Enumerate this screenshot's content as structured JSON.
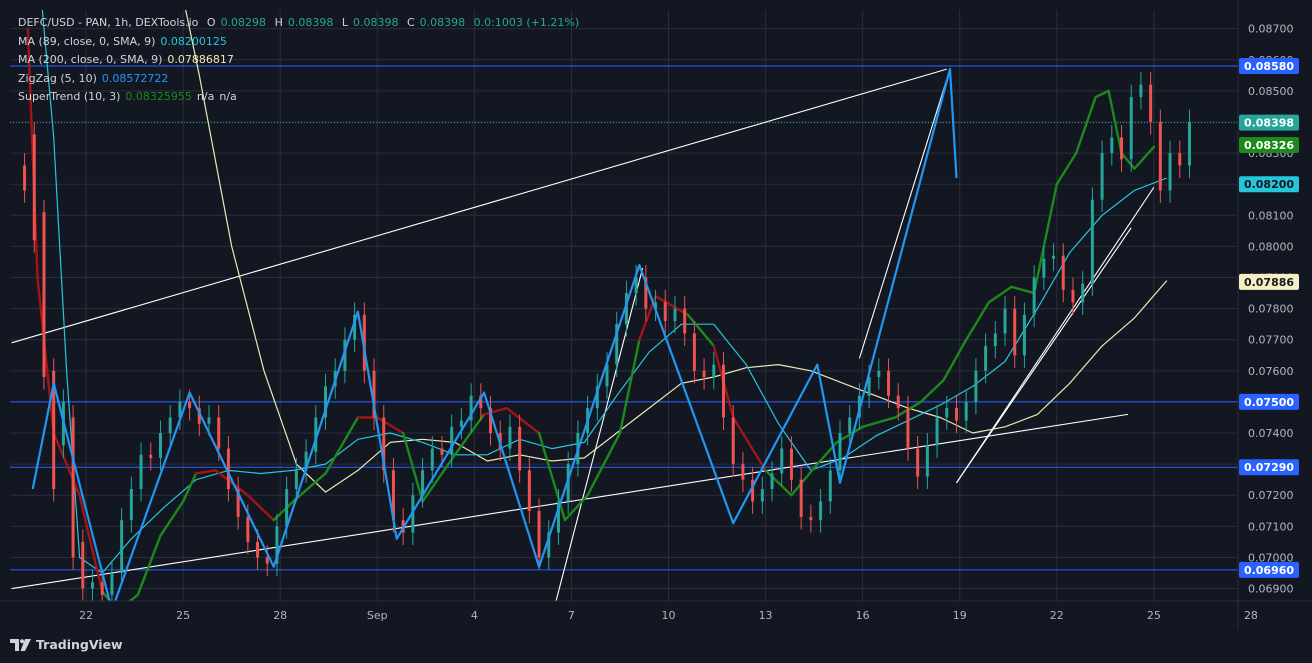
{
  "legend": {
    "symbol": "DEFC/USD - PAN, 1h, DEXTools.io",
    "o_label": "O",
    "o_val": "0.08298",
    "h_label": "H",
    "h_val": "0.08398",
    "l_label": "L",
    "l_val": "0.08398",
    "c_label": "C",
    "c_val": "0.08398",
    "change": "0.0:1003 (+1.21%)",
    "ma89_label": "MA (89, close, 0, SMA, 9)",
    "ma89_val": "0.08200125",
    "ma200_label": "MA (200, close, 0, SMA, 9)",
    "ma200_val": "0.07886817",
    "zz_label": "ZigZag (5, 10)",
    "zz_val": "0.08572722",
    "st_label": "SuperTrend (10, 3)",
    "st_val": "0.08325955",
    "st_na1": "n/a",
    "st_na2": "n/a"
  },
  "footer": {
    "brand": "TradingView"
  },
  "colors": {
    "background": "#131722",
    "grid": "#2a2e39",
    "up": "#26a69a",
    "down": "#ef5350",
    "zigzag": "#2196f3",
    "ma89": "#26c6da",
    "ma200": "#f0e6b4",
    "hline": "#2962ff",
    "trendline": "#ffffff",
    "supertrend_up": "#1b8a1b",
    "supertrend_down": "#a31515"
  },
  "chart_data": {
    "type": "candlestick",
    "title": "DEFC/USD - PAN, 1h, DEXTools.io",
    "y_axis": {
      "ticks": [
        "0.08700",
        "0.08600",
        "0.08500",
        "0.08400",
        "0.08300",
        "0.08200",
        "0.08100",
        "0.08000",
        "0.07900",
        "0.07800",
        "0.07700",
        "0.07600",
        "0.07500",
        "0.07400",
        "0.07300",
        "0.07200",
        "0.07100",
        "0.07000",
        "0.06900"
      ],
      "ylim": [
        0.0686,
        0.0876
      ]
    },
    "x_axis": {
      "ticks": [
        "22",
        "25",
        "28",
        "Sep",
        "4",
        "7",
        "10",
        "13",
        "16",
        "19",
        "22",
        "25",
        "28"
      ],
      "day_index": [
        2,
        5,
        8,
        11,
        14,
        17,
        20,
        23,
        26,
        29,
        32,
        35,
        38
      ]
    },
    "horizontal_levels": [
      {
        "value": 0.0858,
        "label": "0.08580",
        "color": "#2962ff"
      },
      {
        "value": 0.075,
        "label": "0.07500",
        "color": "#2962ff"
      },
      {
        "value": 0.0729,
        "label": "0.07290",
        "color": "#2962ff"
      },
      {
        "value": 0.0696,
        "label": "0.06960",
        "color": "#2962ff"
      }
    ],
    "price_labels": [
      {
        "value": 0.08398,
        "label": "0.08398",
        "bg": "#26a69a",
        "fg": "#ffffff"
      },
      {
        "value": 0.08326,
        "label": "0.08326",
        "bg": "#1b8a1b",
        "fg": "#ffffff"
      },
      {
        "value": 0.082,
        "label": "0.08200",
        "bg": "#26c6da",
        "fg": "#131722"
      },
      {
        "value": 0.07886,
        "label": "0.07886",
        "bg": "#f7efc4",
        "fg": "#131722"
      }
    ],
    "last_price": 0.08398,
    "zigzag": [
      [
        0.0,
        0.0722
      ],
      [
        1.0,
        0.0756
      ],
      [
        2.8,
        0.0683
      ],
      [
        5.3,
        0.0753
      ],
      [
        7.8,
        0.0697
      ],
      [
        10.4,
        0.0779
      ],
      [
        11.6,
        0.0706
      ],
      [
        14.4,
        0.0753
      ],
      [
        16.0,
        0.0697
      ],
      [
        19.0,
        0.0794
      ],
      [
        22.0,
        0.0711
      ],
      [
        24.6,
        0.0762
      ],
      [
        25.3,
        0.0724
      ],
      [
        28.7,
        0.0857
      ],
      [
        29.8,
        0.0822
      ]
    ],
    "zigzag_days": [
      0.35,
      1.0,
      2.8,
      5.2,
      7.8,
      10.4,
      11.6,
      14.3,
      16.0,
      19.1,
      22.0,
      24.6,
      25.3,
      28.7,
      28.9
    ],
    "ma89": [
      [
        0.4,
        0.0905
      ],
      [
        1.0,
        0.0835
      ],
      [
        1.4,
        0.076
      ],
      [
        1.8,
        0.07
      ],
      [
        2.5,
        0.0695
      ],
      [
        3.4,
        0.0706
      ],
      [
        4.4,
        0.0716
      ],
      [
        5.4,
        0.0725
      ],
      [
        6.4,
        0.0728
      ],
      [
        7.4,
        0.0727
      ],
      [
        8.4,
        0.0728
      ],
      [
        9.4,
        0.073
      ],
      [
        10.4,
        0.0738
      ],
      [
        11.4,
        0.074
      ],
      [
        12.4,
        0.0737
      ],
      [
        13.4,
        0.0733
      ],
      [
        14.4,
        0.0733
      ],
      [
        15.4,
        0.0738
      ],
      [
        16.4,
        0.0735
      ],
      [
        17.4,
        0.0737
      ],
      [
        18.4,
        0.0752
      ],
      [
        19.4,
        0.0766
      ],
      [
        20.4,
        0.0775
      ],
      [
        21.4,
        0.0775
      ],
      [
        22.4,
        0.0762
      ],
      [
        23.4,
        0.0743
      ],
      [
        24.4,
        0.0728
      ],
      [
        25.4,
        0.0732
      ],
      [
        26.4,
        0.0739
      ],
      [
        27.4,
        0.0744
      ],
      [
        28.4,
        0.0749
      ],
      [
        29.4,
        0.0755
      ],
      [
        30.4,
        0.0763
      ],
      [
        31.4,
        0.078
      ],
      [
        32.4,
        0.0798
      ],
      [
        33.4,
        0.081
      ],
      [
        34.4,
        0.0818
      ],
      [
        35.4,
        0.0822
      ]
    ],
    "ma200": [
      [
        4.5,
        0.0905
      ],
      [
        5.5,
        0.0855
      ],
      [
        6.5,
        0.08
      ],
      [
        7.5,
        0.076
      ],
      [
        8.5,
        0.073
      ],
      [
        9.4,
        0.0721
      ],
      [
        10.4,
        0.0728
      ],
      [
        11.4,
        0.0737
      ],
      [
        12.4,
        0.0738
      ],
      [
        13.4,
        0.0737
      ],
      [
        14.4,
        0.0731
      ],
      [
        15.4,
        0.0733
      ],
      [
        16.4,
        0.0731
      ],
      [
        17.4,
        0.0732
      ],
      [
        18.4,
        0.074
      ],
      [
        19.4,
        0.0748
      ],
      [
        20.4,
        0.0756
      ],
      [
        21.4,
        0.0758
      ],
      [
        22.4,
        0.0761
      ],
      [
        23.4,
        0.0762
      ],
      [
        24.4,
        0.076
      ],
      [
        25.4,
        0.0756
      ],
      [
        26.4,
        0.0752
      ],
      [
        27.4,
        0.0748
      ],
      [
        28.4,
        0.0745
      ],
      [
        29.4,
        0.074
      ],
      [
        30.4,
        0.0742
      ],
      [
        31.4,
        0.0746
      ],
      [
        32.4,
        0.0756
      ],
      [
        33.4,
        0.0768
      ],
      [
        34.4,
        0.0777
      ],
      [
        35.4,
        0.0789
      ]
    ],
    "supertrend": [
      [
        0.2,
        0.087,
        "d"
      ],
      [
        0.5,
        0.079,
        "d"
      ],
      [
        1.0,
        0.074,
        "d"
      ],
      [
        1.8,
        0.072,
        "d"
      ],
      [
        2.5,
        0.0689,
        "d"
      ],
      [
        3.0,
        0.0683,
        "u"
      ],
      [
        3.6,
        0.0688,
        "u"
      ],
      [
        4.3,
        0.0707,
        "u"
      ],
      [
        5.0,
        0.0718,
        "u"
      ],
      [
        5.4,
        0.0727,
        "u"
      ],
      [
        6.0,
        0.0728,
        "d"
      ],
      [
        7.0,
        0.072,
        "d"
      ],
      [
        7.8,
        0.0712,
        "d"
      ],
      [
        8.4,
        0.0718,
        "u"
      ],
      [
        9.4,
        0.0727,
        "u"
      ],
      [
        10.4,
        0.0745,
        "u"
      ],
      [
        11.0,
        0.0745,
        "d"
      ],
      [
        11.8,
        0.074,
        "d"
      ],
      [
        12.4,
        0.0718,
        "u"
      ],
      [
        13.4,
        0.0733,
        "u"
      ],
      [
        14.3,
        0.0746,
        "u"
      ],
      [
        15.0,
        0.0748,
        "d"
      ],
      [
        16.0,
        0.074,
        "d"
      ],
      [
        16.8,
        0.0712,
        "u"
      ],
      [
        17.5,
        0.072,
        "u"
      ],
      [
        18.5,
        0.074,
        "u"
      ],
      [
        19.1,
        0.077,
        "u"
      ],
      [
        19.6,
        0.0784,
        "d"
      ],
      [
        20.6,
        0.0778,
        "d"
      ],
      [
        21.4,
        0.0768,
        "u"
      ],
      [
        22.0,
        0.0745,
        "d"
      ],
      [
        23.0,
        0.0728,
        "d"
      ],
      [
        23.8,
        0.072,
        "u"
      ],
      [
        24.6,
        0.073,
        "u"
      ],
      [
        25.2,
        0.0737,
        "u"
      ],
      [
        26.0,
        0.0742,
        "u"
      ],
      [
        27.0,
        0.0745,
        "u"
      ],
      [
        27.8,
        0.075,
        "u"
      ],
      [
        28.5,
        0.0757,
        "u"
      ],
      [
        29.2,
        0.077,
        "u"
      ],
      [
        29.9,
        0.0782,
        "u"
      ],
      [
        30.6,
        0.0787,
        "u"
      ],
      [
        31.3,
        0.0785,
        "u"
      ],
      [
        32.0,
        0.082,
        "u"
      ],
      [
        32.6,
        0.083,
        "u"
      ],
      [
        33.2,
        0.0848,
        "u"
      ],
      [
        33.6,
        0.085,
        "u"
      ],
      [
        34.0,
        0.083,
        "u"
      ],
      [
        34.4,
        0.0825,
        "u"
      ],
      [
        35.0,
        0.0832,
        "u"
      ]
    ],
    "trendlines": [
      {
        "from": [
          -0.3,
          0.0769
        ],
        "to": [
          28.6,
          0.0857
        ]
      },
      {
        "from": [
          -0.3,
          0.069
        ],
        "to": [
          34.2,
          0.0746
        ]
      },
      {
        "from": [
          28.9,
          0.0724
        ],
        "to": [
          35.0,
          0.0819
        ]
      },
      {
        "from": [
          28.9,
          0.0724
        ],
        "to": [
          34.3,
          0.0806
        ]
      },
      {
        "from": [
          16.5,
          0.0685
        ],
        "to": [
          19.2,
          0.0793
        ]
      },
      {
        "from": [
          25.9,
          0.0764
        ],
        "to": [
          28.7,
          0.0857
        ]
      }
    ],
    "candles": [
      [
        0.1,
        0.0826,
        0.0818
      ],
      [
        0.4,
        0.0836,
        0.0802
      ],
      [
        0.7,
        0.0811,
        0.0758
      ],
      [
        1.0,
        0.076,
        0.0722
      ],
      [
        1.3,
        0.0736,
        0.075
      ],
      [
        1.6,
        0.0745,
        0.07
      ],
      [
        1.9,
        0.0705,
        0.069
      ],
      [
        2.2,
        0.069,
        0.0692
      ],
      [
        2.5,
        0.0692,
        0.0688
      ],
      [
        2.8,
        0.0688,
        0.0695
      ],
      [
        3.1,
        0.0695,
        0.0712
      ],
      [
        3.4,
        0.0712,
        0.0722
      ],
      [
        3.7,
        0.0722,
        0.0733
      ],
      [
        4.0,
        0.0733,
        0.0732
      ],
      [
        4.3,
        0.0732,
        0.074
      ],
      [
        4.6,
        0.074,
        0.0745
      ],
      [
        4.9,
        0.0745,
        0.075
      ],
      [
        5.2,
        0.075,
        0.0748
      ],
      [
        5.5,
        0.0748,
        0.0743
      ],
      [
        5.8,
        0.0743,
        0.0745
      ],
      [
        6.1,
        0.0745,
        0.0735
      ],
      [
        6.4,
        0.0735,
        0.0722
      ],
      [
        6.7,
        0.0722,
        0.0713
      ],
      [
        7.0,
        0.0713,
        0.0705
      ],
      [
        7.3,
        0.0705,
        0.07
      ],
      [
        7.6,
        0.07,
        0.0698
      ],
      [
        7.9,
        0.0698,
        0.071
      ],
      [
        8.2,
        0.071,
        0.0722
      ],
      [
        8.5,
        0.0722,
        0.0728
      ],
      [
        8.8,
        0.0728,
        0.0734
      ],
      [
        9.1,
        0.0734,
        0.0745
      ],
      [
        9.4,
        0.0745,
        0.0755
      ],
      [
        9.7,
        0.0755,
        0.076
      ],
      [
        10.0,
        0.076,
        0.077
      ],
      [
        10.3,
        0.077,
        0.0778
      ],
      [
        10.6,
        0.0778,
        0.076
      ],
      [
        10.9,
        0.076,
        0.0745
      ],
      [
        11.2,
        0.0745,
        0.0728
      ],
      [
        11.5,
        0.0728,
        0.0712
      ],
      [
        11.8,
        0.0712,
        0.0708
      ],
      [
        12.1,
        0.0708,
        0.072
      ],
      [
        12.4,
        0.072,
        0.0728
      ],
      [
        12.7,
        0.0728,
        0.0735
      ],
      [
        13.0,
        0.0735,
        0.0733
      ],
      [
        13.3,
        0.0733,
        0.0742
      ],
      [
        13.6,
        0.0742,
        0.0744
      ],
      [
        13.9,
        0.0744,
        0.0752
      ],
      [
        14.2,
        0.0752,
        0.0748
      ],
      [
        14.5,
        0.0748,
        0.074
      ],
      [
        14.8,
        0.074,
        0.0735
      ],
      [
        15.1,
        0.0735,
        0.0742
      ],
      [
        15.4,
        0.0742,
        0.0728
      ],
      [
        15.7,
        0.0728,
        0.0715
      ],
      [
        16.0,
        0.0715,
        0.07
      ],
      [
        16.3,
        0.07,
        0.0708
      ],
      [
        16.6,
        0.0708,
        0.0718
      ],
      [
        16.9,
        0.0718,
        0.073
      ],
      [
        17.2,
        0.073,
        0.074
      ],
      [
        17.5,
        0.074,
        0.0748
      ],
      [
        17.8,
        0.0748,
        0.0755
      ],
      [
        18.1,
        0.0755,
        0.0762
      ],
      [
        18.4,
        0.0762,
        0.0775
      ],
      [
        18.7,
        0.0775,
        0.0785
      ],
      [
        19.0,
        0.0785,
        0.079
      ],
      [
        19.3,
        0.079,
        0.078
      ],
      [
        19.6,
        0.078,
        0.0782
      ],
      [
        19.9,
        0.0782,
        0.0776
      ],
      [
        20.2,
        0.0776,
        0.078
      ],
      [
        20.5,
        0.078,
        0.0772
      ],
      [
        20.8,
        0.0772,
        0.076
      ],
      [
        21.1,
        0.076,
        0.0758
      ],
      [
        21.4,
        0.0758,
        0.0762
      ],
      [
        21.7,
        0.0762,
        0.0745
      ],
      [
        22.0,
        0.0745,
        0.073
      ],
      [
        22.3,
        0.073,
        0.0725
      ],
      [
        22.6,
        0.0725,
        0.0718
      ],
      [
        22.9,
        0.0718,
        0.0722
      ],
      [
        23.2,
        0.0722,
        0.0727
      ],
      [
        23.5,
        0.0727,
        0.0735
      ],
      [
        23.8,
        0.0735,
        0.0725
      ],
      [
        24.1,
        0.0725,
        0.0713
      ],
      [
        24.4,
        0.0713,
        0.0712
      ],
      [
        24.7,
        0.0712,
        0.0718
      ],
      [
        25.0,
        0.0718,
        0.0728
      ],
      [
        25.3,
        0.0728,
        0.074
      ],
      [
        25.6,
        0.074,
        0.0745
      ],
      [
        25.9,
        0.0745,
        0.0752
      ],
      [
        26.2,
        0.0752,
        0.0758
      ],
      [
        26.5,
        0.0758,
        0.076
      ],
      [
        26.8,
        0.076,
        0.0752
      ],
      [
        27.1,
        0.0752,
        0.0748
      ],
      [
        27.4,
        0.0748,
        0.0735
      ],
      [
        27.7,
        0.0735,
        0.0726
      ],
      [
        28.0,
        0.0726,
        0.0736
      ],
      [
        28.3,
        0.0736,
        0.0745
      ],
      [
        28.6,
        0.0745,
        0.0748
      ],
      [
        28.9,
        0.0748,
        0.0744
      ],
      [
        29.2,
        0.0744,
        0.075
      ],
      [
        29.5,
        0.075,
        0.076
      ],
      [
        29.8,
        0.076,
        0.0768
      ],
      [
        30.1,
        0.0768,
        0.0772
      ],
      [
        30.4,
        0.0772,
        0.078
      ],
      [
        30.7,
        0.078,
        0.0765
      ],
      [
        31.0,
        0.0765,
        0.0778
      ],
      [
        31.3,
        0.0778,
        0.079
      ],
      [
        31.6,
        0.079,
        0.0796
      ],
      [
        31.9,
        0.0796,
        0.0797
      ],
      [
        32.2,
        0.0797,
        0.0786
      ],
      [
        32.5,
        0.0786,
        0.0782
      ],
      [
        32.8,
        0.0782,
        0.0788
      ],
      [
        33.1,
        0.0788,
        0.0815
      ],
      [
        33.4,
        0.0815,
        0.083
      ],
      [
        33.7,
        0.083,
        0.0835
      ],
      [
        34.0,
        0.0835,
        0.0828
      ],
      [
        34.3,
        0.0828,
        0.0848
      ],
      [
        34.6,
        0.0848,
        0.0852
      ],
      [
        34.9,
        0.0852,
        0.084
      ],
      [
        35.2,
        0.084,
        0.0818
      ],
      [
        35.5,
        0.0818,
        0.083
      ],
      [
        35.8,
        0.083,
        0.0826
      ],
      [
        36.1,
        0.0826,
        0.084
      ]
    ]
  }
}
